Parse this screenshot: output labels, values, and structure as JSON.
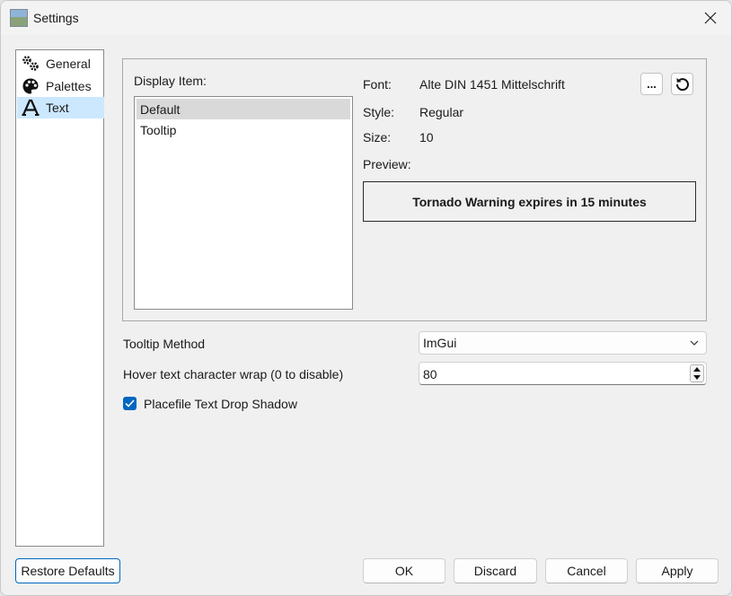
{
  "window": {
    "title": "Settings"
  },
  "nav": {
    "items": [
      {
        "label": "General",
        "icon": "gears-icon",
        "selected": false
      },
      {
        "label": "Palettes",
        "icon": "palette-icon",
        "selected": false
      },
      {
        "label": "Text",
        "icon": "text-a-icon",
        "selected": true
      }
    ]
  },
  "display": {
    "label": "Display Item:",
    "items": [
      {
        "label": "Default",
        "selected": true
      },
      {
        "label": "Tooltip",
        "selected": false
      }
    ]
  },
  "font": {
    "font_label": "Font:",
    "font_value": "Alte DIN 1451 Mittelschrift",
    "style_label": "Style:",
    "style_value": "Regular",
    "size_label": "Size:",
    "size_value": "10",
    "preview_label": "Preview:",
    "preview_text": "Tornado Warning expires in 15 minutes",
    "browse_label": "...",
    "reset_icon": "reset-icon"
  },
  "tooltip_method": {
    "label": "Tooltip Method",
    "value": "ImGui"
  },
  "hover_wrap": {
    "label": "Hover text character wrap (0 to disable)",
    "value": "80"
  },
  "drop_shadow": {
    "label": "Placefile Text Drop Shadow",
    "checked": true
  },
  "buttons": {
    "restore": "Restore Defaults",
    "ok": "OK",
    "discard": "Discard",
    "cancel": "Cancel",
    "apply": "Apply"
  },
  "colors": {
    "accent": "#0067c0",
    "selection": "#cce8ff"
  }
}
